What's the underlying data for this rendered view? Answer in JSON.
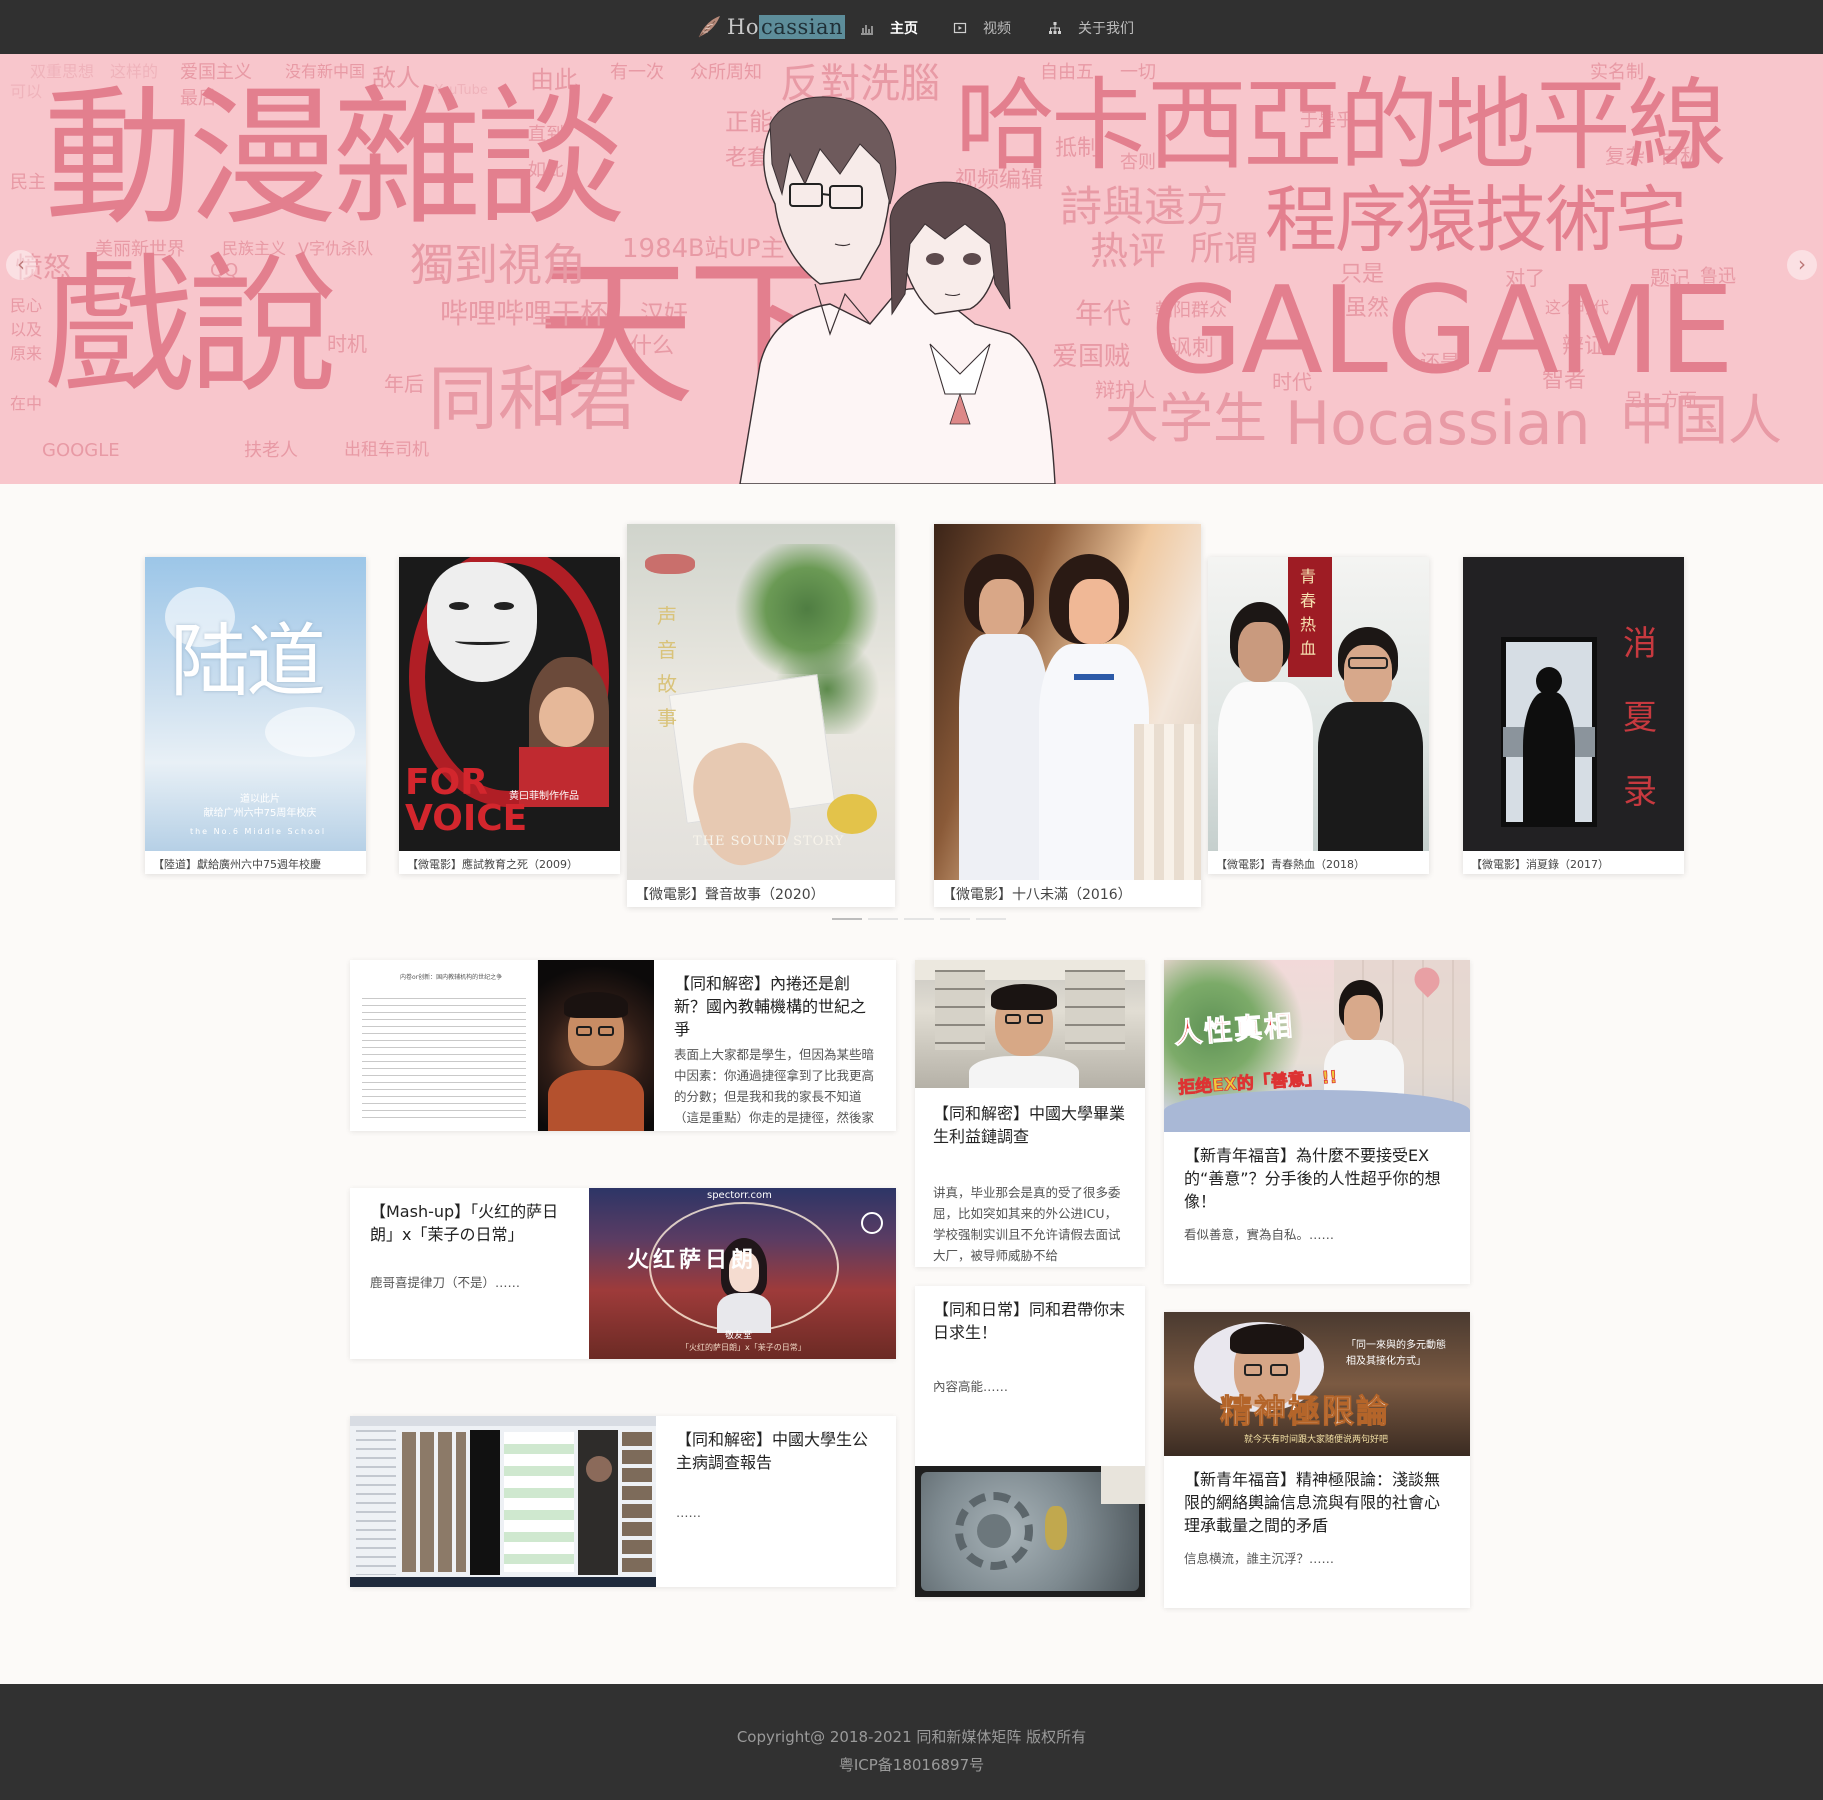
{
  "nav": {
    "brand": "Hocassian",
    "brand_icon": "feather-leaf-logo",
    "items": [
      {
        "label": "主页",
        "icon": "bar-chart-icon",
        "active": true
      },
      {
        "label": "视频",
        "icon": "video-icon",
        "active": false
      },
      {
        "label": "关于我们",
        "icon": "sitemap-icon",
        "active": false
      }
    ]
  },
  "banner": {
    "big_words": [
      "動漫雜談",
      "哈卡西亞的地平線",
      "戲說",
      "天下",
      "GALGAME",
      "程序猿技術宅",
      "詩與遠方",
      "大学生",
      "Hocassian",
      "中国人",
      "同和君",
      "獨到視角",
      "哔哩哔哩干杯",
      "反對洗腦",
      "热评",
      "所谓"
    ],
    "small_words": [
      "双重思想",
      "这样的",
      "爱国主义",
      "没有新中国",
      "敌人",
      "YouTube",
      "由此",
      "有一次",
      "众所周知",
      "自由五",
      "一切",
      "实名制",
      "可以",
      "最后",
      "直到",
      "如此",
      "正能量",
      "老套",
      "视频编辑",
      "抵制",
      "杏则",
      "于是乎",
      "复杂",
      "自私",
      "美丽新世界",
      "民族主义",
      "V字仇杀队",
      "1984",
      "B站UP主",
      "QQ",
      "愤怒",
      "汉奸",
      "什么",
      "时机",
      "年代",
      "爱国贼",
      "辩护人",
      "对了",
      "题记",
      "鲁迅",
      "这个时代",
      "讽刺",
      "辩证",
      "还是",
      "智者",
      "时代",
      "另一方面",
      "GOOGLE",
      "扶老人",
      "出租车司机",
      "年后",
      "民主",
      "民心",
      "以及",
      "原来",
      "在中",
      "只是",
      "虽然",
      "朝阳群众"
    ],
    "colors": {
      "background": "#f8c6cc",
      "word": "#e89aa5",
      "word_dark": "#e37f8e"
    }
  },
  "carousel": {
    "items": [
      {
        "caption": "【陸道】獻給廣州六中75週年校慶",
        "poster_text": "陆道",
        "poster_sub": "道以此片\n献给广州六中75周年校庆",
        "poster_en": "the No.6 Middle School"
      },
      {
        "caption": "【微電影】應試教育之死（2009）",
        "poster_text": "FOR VOICE",
        "poster_sub": "黄曰菲制作作品"
      },
      {
        "caption": "【微電影】聲音故事（2020）",
        "poster_text": "声音故事",
        "poster_sub": "THE SOUND STORY"
      },
      {
        "caption": "【微電影】十八未滿（2016）",
        "poster_text": ""
      },
      {
        "caption": "【微電影】青春熱血（2018）",
        "poster_text": "青春热血"
      },
      {
        "caption": "【微電影】消夏錄（2017）",
        "poster_text": "消夏录"
      }
    ],
    "dots": 5,
    "active_dot": 0
  },
  "articles": [
    {
      "title": "【同和解密】內捲还是創新？國內教輔機構的世紀之爭",
      "excerpt": "表面上大家都是學生，但因為某些暗中因素：你通過捷徑拿到了比我更高的分數；但是我和我的家長不知道（這是重點）你走的是捷徑，然後家"
    },
    {
      "title": "【同和解密】中國大學畢業生利益鏈調查",
      "excerpt": "讲真，毕业那会是真的受了很多委屈，比如突如其来的外公进ICU，学校强制实训且不允许请假去面试大厂，被导师威胁不给"
    },
    {
      "title": "【新青年福音】為什麼不要接受EX的“善意”？分手後的人性超乎你的想像！",
      "excerpt": "看似善意，實為自私。……",
      "thumb_text": "人性真相",
      "thumb_sub": "拒绝EX的「善意」!!"
    },
    {
      "title": "【Mash-up】「火红的萨日朗」x「茉子の日常」",
      "excerpt": "鹿哥喜提律刀（不是）……",
      "thumb_text": "火红萨日朗",
      "thumb_sub": "敬友堂",
      "thumb_line": "「火红的萨日朗」x「茉子の日常」",
      "watermark": "spectorr.com"
    },
    {
      "title": "【同和日常】同和君帶你末日求生！",
      "excerpt": "內容高能……"
    },
    {
      "title": "【新青年福音】精神極限論：淺談無限的網絡輿論信息流與有限的社會心理承載量之間的矛盾",
      "excerpt": "信息横流，誰主沉浮？……",
      "thumb_text": "精神極限論",
      "thumb_quote": "「同一來與的多元動態\n相及其接化方式」",
      "thumb_sub": "就今天有时间跟大家随便说两句好吧"
    },
    {
      "title": "【同和解密】中國大學生公主病調查報告",
      "excerpt": "……"
    },
    {
      "thumb_only": true
    }
  ],
  "doc_thumb": {
    "title": "内卷or创新：国内教辅机构的世纪之争"
  },
  "footer": {
    "copyright": "Copyright@ 2018-2021 同和新媒体矩阵 版权所有",
    "icp": "粤ICP备18016897号"
  }
}
